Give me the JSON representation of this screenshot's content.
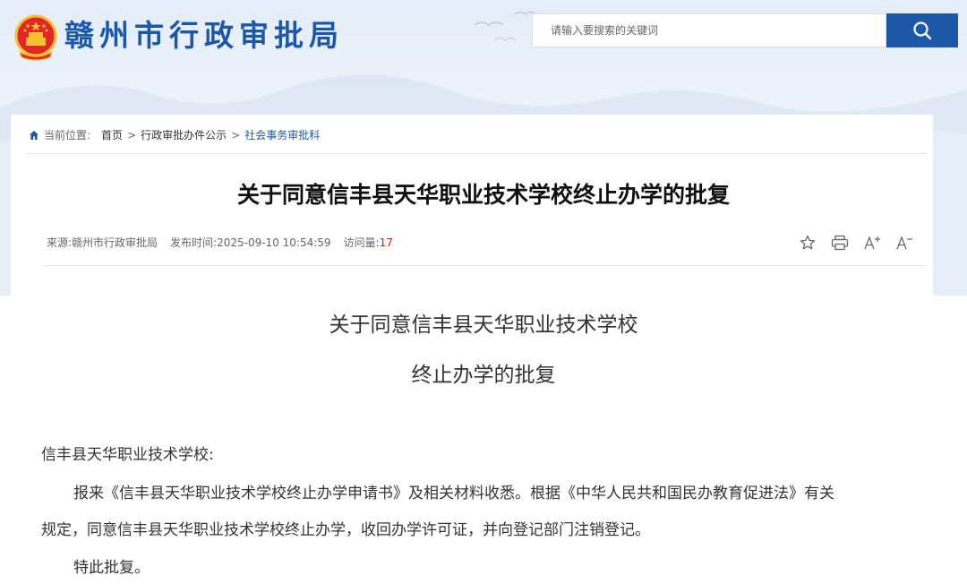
{
  "header": {
    "site_title": "赣州市行政审批局",
    "search_placeholder": "请输入要搜索的关键词",
    "search_icon": "search-icon",
    "brand_color": "#1d58a8"
  },
  "breadcrumb": {
    "label": "当前位置:",
    "items": [
      "首页",
      "行政审批办件公示",
      "社会事务审批科"
    ],
    "separator": ">"
  },
  "article": {
    "title": "关于同意信丰县天华职业技术学校终止办学的批复",
    "source": "来源:赣州市行政审批局",
    "publish_time": "发布时间:2025-09-10 10:54:59",
    "visits_label": "访问量:",
    "visits": "17",
    "tools": [
      "star-icon",
      "print-icon",
      "font-increase-icon",
      "font-decrease-icon"
    ]
  },
  "document": {
    "title_line1": "关于同意信丰县天华职业技术学校",
    "title_line2": "终止办学的批复",
    "salutation": "信丰县天华职业技术学校:",
    "para1_line1": "报来《信丰县天华职业技术学校终止办学申请书》及相关材料收悉。根据《中华人民共和国民办教育促进法》有关",
    "para1_line2": "规定，同意信丰县天华职业技术学校终止办学，收回办学许可证，并向登记部门注销登记。",
    "closing": "特此批复。"
  }
}
